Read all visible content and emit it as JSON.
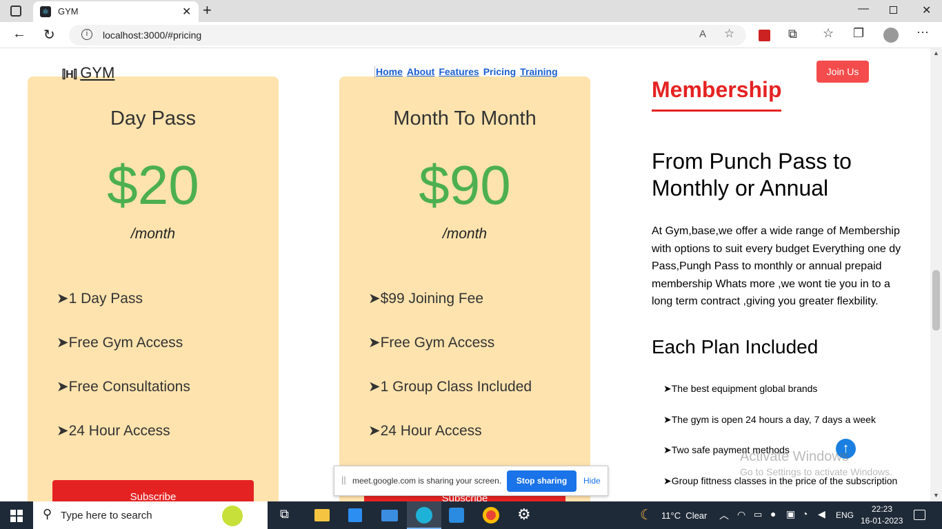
{
  "browser": {
    "tab_title": "GYM",
    "url": "localhost:3000/#pricing"
  },
  "navbar": {
    "logo": "GYM",
    "links": [
      "Home",
      "About",
      "Features",
      "Pricing",
      "Training"
    ],
    "join": "Join Us"
  },
  "cards": [
    {
      "title": "Day Pass",
      "price": "$20",
      "period": "/month",
      "features": [
        "➤1 Day Pass",
        "➤Free Gym Access",
        "➤Free Consultations",
        "➤24 Hour Access"
      ],
      "button": "Subscribe"
    },
    {
      "title": "Month To Month",
      "price": "$90",
      "period": "/month",
      "features": [
        "➤$99 Joining Fee",
        "➤Free Gym Access",
        "➤1 Group Class Included",
        "➤24 Hour Access"
      ],
      "button": "Subscribe"
    }
  ],
  "membership": {
    "heading": "Membership",
    "subheading_line1": "From Punch Pass to",
    "subheading_line2": "Monthly or Annual",
    "paragraph": "At Gym,base,we offer a wide range of Membership with options to suit every budget Everything one dy Pass,Pungh Pass to monthly or annual prepaid membership Whats more ,we wont tie you in to a long term contract ,giving you greater flexbility.",
    "plan_heading": "Each Plan Included",
    "plan_items": [
      "➤The best equipment global brands",
      "➤The gym is open 24 hours a day, 7 days a week",
      "➤Two safe payment methods",
      "➤Group fittness classes in the price of the subscription"
    ]
  },
  "overlays": {
    "share_text": "meet.google.com is sharing your screen.",
    "stop_sharing": "Stop sharing",
    "hide": "Hide",
    "activate_title": "Activate Windows",
    "activate_sub": "Go to Settings to activate Windows."
  },
  "taskbar": {
    "search_placeholder": "Type here to search",
    "weather": "11°C  Clear",
    "lang": "ENG",
    "time": "22:23",
    "date": "16-01-2023"
  },
  "colors": {
    "card_bg": "#fee3ae",
    "price": "#4caf50",
    "accent_red": "#e52222",
    "join_button": "#f44c4c",
    "link_blue": "#1a5fd0"
  }
}
